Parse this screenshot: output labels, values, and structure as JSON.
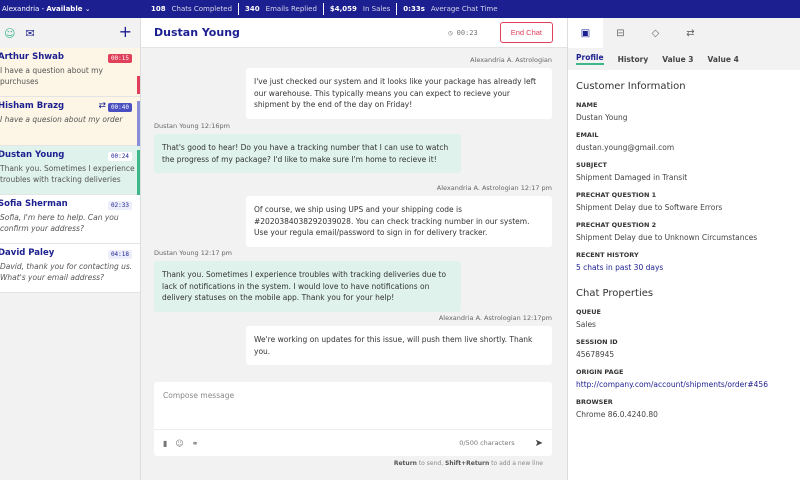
{
  "topbar": {
    "agent": "Alexandria",
    "status": "Available",
    "stats": [
      {
        "value": "108",
        "label": "Chats Completed"
      },
      {
        "value": "340",
        "label": "Emails Replied"
      },
      {
        "value": "$4,059",
        "label": "In Sales"
      },
      {
        "value": "0:33s",
        "label": "Average Chat Time"
      }
    ]
  },
  "sidebar": {
    "items": [
      {
        "name": "Arthur Shwab",
        "preview": "I have a question about my purchuses",
        "time": "00:15",
        "italic": false,
        "bg": "#fdf6e6",
        "badge_bg": "#e0405a",
        "badge_fg": "#fff",
        "bar": "#e0405a"
      },
      {
        "name": "Hisham Brazg",
        "preview": "I have a quesion about my order",
        "time": "00:40",
        "italic": true,
        "bg": "#fdf6e6",
        "badge_bg": "#4a4fc0",
        "badge_fg": "#fff",
        "bar": "#8a8ed8",
        "transfer": true
      },
      {
        "name": "Dustan Young",
        "preview": "Thank you. Sometimes I experience troubles with tracking deliveries due...",
        "time": "00:24",
        "italic": false,
        "bg": "#dff3ec",
        "badge_bg": "#fff",
        "badge_fg": "#1c1f8f",
        "bar": "#3cb88b"
      },
      {
        "name": "Sofia Sherman",
        "preview": "Sofia, I'm here to help. Can you confirm your address?",
        "time": "02:33",
        "italic": true,
        "bg": "#fff",
        "badge_bg": "#eceefb",
        "badge_fg": "#1c1f8f"
      },
      {
        "name": "David Paley",
        "preview": "David, thank you for contacting us. What's your email address?",
        "time": "04:18",
        "italic": true,
        "bg": "#fff",
        "badge_bg": "#eceefb",
        "badge_fg": "#1c1f8f"
      }
    ]
  },
  "chat": {
    "title": "Dustan Young",
    "timer": "00:23",
    "end_label": "End Chat",
    "messages": [
      {
        "meta": "Alexandria A. Astrologian",
        "text": "I've just checked our system and it looks like your package has already left our warehouse.  This typically means you can expect to recieve your shipment by the end of the day on Friday!"
      },
      {
        "meta": "Dustan Young 12:16pm",
        "text": "That's good to hear!  Do you have a tracking number that I can use to watch the progress of my package?  I'd like to make sure I'm home to recieve it!"
      },
      {
        "meta": "Alexandria A. Astrologian   12:17 pm",
        "text": "Of course, we ship using UPS and your shipping code is #202038403829203902​8. You  can check tracking number in our system. Use your regula email/password to sign in for delivery tracker."
      },
      {
        "meta": "Dustan Young 12:17 pm",
        "text": "Thank you. Sometimes I experience troubles with tracking deliveries due to lack of notifications in the system. I would love to have notifications on delivery statuses on the mobile app. Thank you for your help!"
      },
      {
        "meta": "Alexandria A. Astrologian   12:17pm",
        "text": "We're working on updates for this issue, will push them live shortly. Thank you."
      }
    ],
    "compose_placeholder": "Compose message",
    "char_count": "0/500 characters",
    "hint": {
      "k1": "Return",
      "t1": " to send, ",
      "k2": "Shift+Return",
      "t2": " to add a new line"
    }
  },
  "panel": {
    "tabs": [
      "Profile",
      "History",
      "Value 3",
      "Value 4"
    ],
    "customer_title": "Customer Information",
    "customer": [
      {
        "label": "NAME",
        "value": "Dustan Young"
      },
      {
        "label": "EMAIL",
        "value": "dustan.young@gmail.com"
      },
      {
        "label": "SUBJECT",
        "value": "Shipment Damaged in Transit"
      },
      {
        "label": "PRECHAT QUESTION 1",
        "value": "Shipment Delay due to Software Errors"
      },
      {
        "label": "PRECHAT QUESTION 2",
        "value": "Shipment Delay due to Unknown Circumstances"
      },
      {
        "label": "RECENT HISTORY",
        "value": "5 chats in past 30 days",
        "link": true
      }
    ],
    "props_title": "Chat Properties",
    "props": [
      {
        "label": "QUEUE",
        "value": "Sales"
      },
      {
        "label": "SESSION ID",
        "value": "45678945"
      },
      {
        "label": "ORIGIN PAGE",
        "value": "http://company.com/account/shipments/order#456",
        "link": true
      },
      {
        "label": "BROWSER",
        "value": "Chrome 86.0.4240.80"
      }
    ]
  }
}
